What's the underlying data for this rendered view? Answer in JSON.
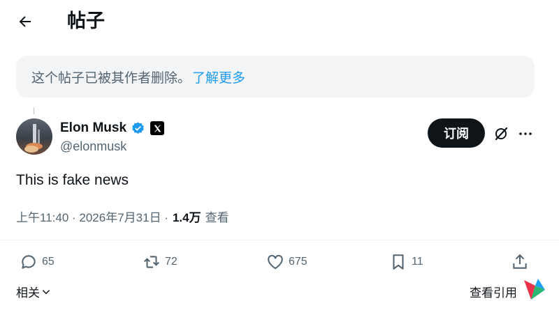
{
  "header": {
    "title": "帖子"
  },
  "notice": {
    "text": "这个帖子已被其作者删除。",
    "link": "了解更多"
  },
  "post": {
    "author_name": "Elon Musk",
    "handle": "@elonmusk",
    "subscribe_label": "订阅",
    "text": "This is fake news",
    "meta": {
      "time": "上午11:40 · 2026年7月31日 · ",
      "views": "1.4万",
      "views_label": "查看"
    },
    "actions": {
      "replies": "65",
      "reposts": "72",
      "likes": "675",
      "bookmarks": "11"
    }
  },
  "footer": {
    "related": "相关",
    "view_quotes": "查看引用"
  },
  "colors": {
    "accent": "#1d9bf0",
    "text": "#0f1419",
    "muted": "#536471",
    "notice_bg": "#f2f4f5"
  }
}
